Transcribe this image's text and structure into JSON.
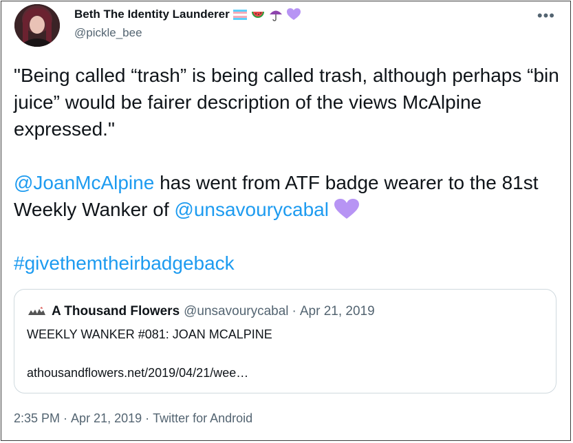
{
  "author": {
    "display_name": "Beth The Identity Launderer",
    "handle": "@pickle_bee",
    "name_emojis": [
      "trans-flag-icon",
      "watermelon-icon",
      "umbrella-icon",
      "purple-heart-icon"
    ]
  },
  "more_icon": "more-options-icon",
  "tweet": {
    "para1": "\"Being called “trash”  is being called trash, although perhaps “bin juice” would be fairer description of the views McAlpine expressed.\"",
    "mention1": "@JoanMcAlpine",
    "para2_mid": " has went from ATF badge wearer to the 81st Weekly Wanker of ",
    "mention2": "@unsavourycabal",
    "hashtag": "#givethemtheirbadgeback"
  },
  "quote": {
    "name": "A Thousand Flowers",
    "handle": "@unsavourycabal",
    "separator": "·",
    "date": "Apr 21, 2019",
    "text": "WEEKLY WANKER #081: JOAN MCALPINE",
    "url": "athousandflowers.net/2019/04/21/wee…"
  },
  "footer": {
    "time": "2:35 PM",
    "sep": "·",
    "date": "Apr 21, 2019",
    "source": "Twitter for Android"
  },
  "colors": {
    "link": "#1d9bf0",
    "text": "#0f1419",
    "secondary": "#536471",
    "heart": "#b794f4"
  }
}
